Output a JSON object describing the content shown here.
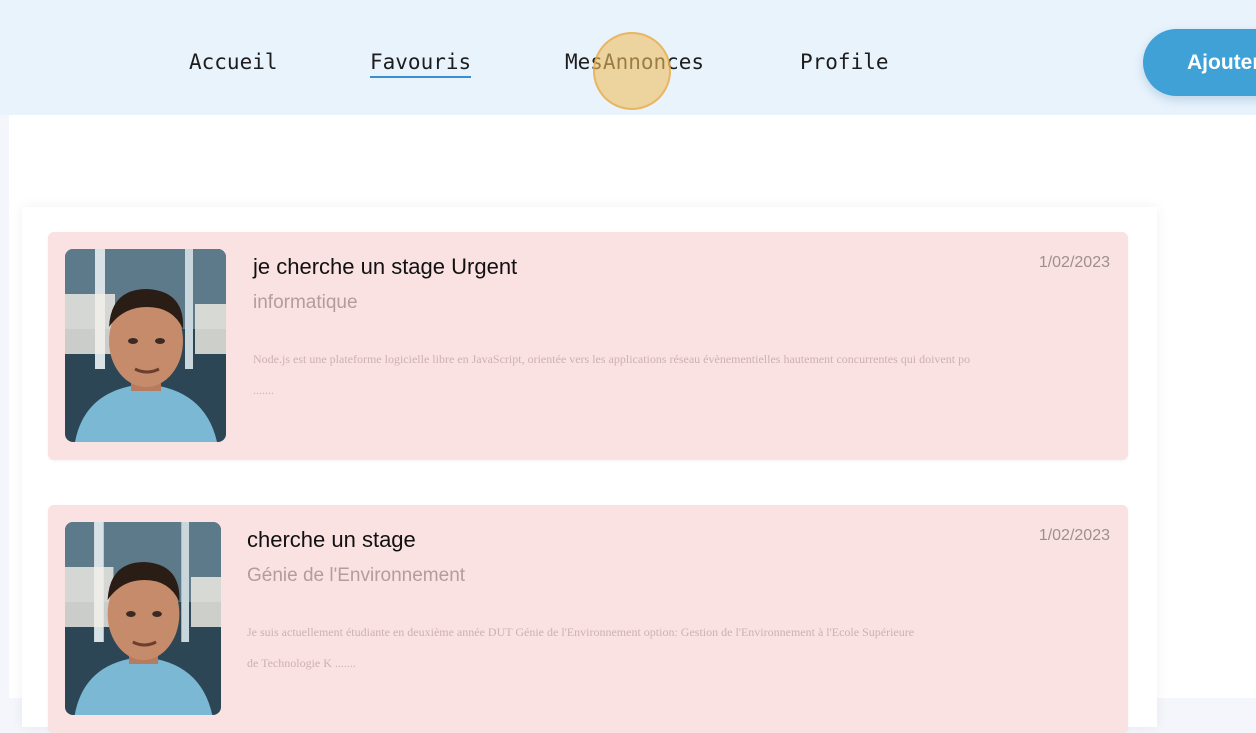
{
  "nav": {
    "links": [
      {
        "label": "Accueil"
      },
      {
        "label": "Favouris"
      },
      {
        "label": "MesAnnonces"
      },
      {
        "label": "Profile"
      }
    ],
    "add_button_label": "Ajouter"
  },
  "annonces": [
    {
      "title": "je cherche un stage Urgent",
      "category": "informatique",
      "description": "Node.js est une plateforme logicielle libre en JavaScript, orientée vers les applications réseau évènementielles hautement concurrentes qui doivent po .......",
      "date": "1/02/2023"
    },
    {
      "title": "cherche un stage",
      "category": "Génie de l'Environnement",
      "description": "Je suis actuellement étudiante en deuxième année DUT Génie de l'Environnement option: Gestion de l'Environnement à l'Ecole Supérieure de Technologie K .......",
      "date": "1/02/2023"
    }
  ],
  "colors": {
    "navbar_bg": "#e9f3fc",
    "accent": "#3fa1d5",
    "card_bg": "#fbe2e2"
  }
}
